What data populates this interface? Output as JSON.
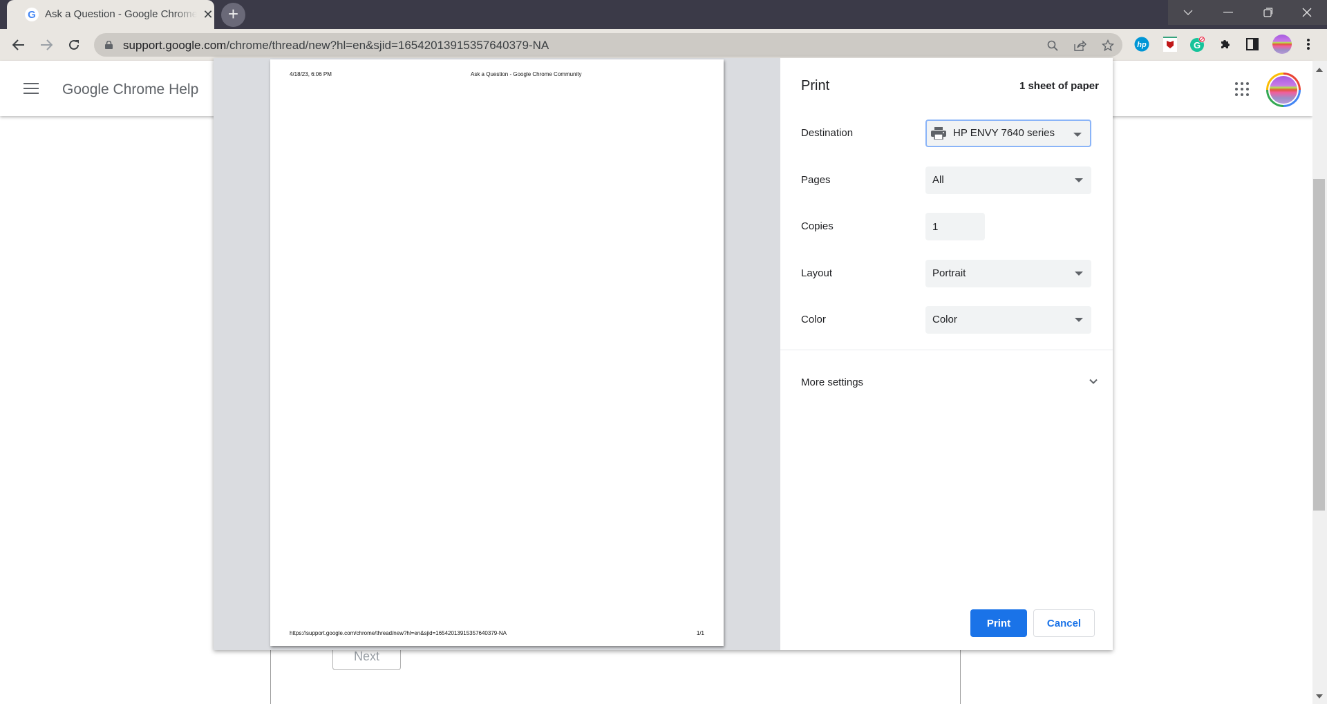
{
  "browser": {
    "tab": {
      "title": "Ask a Question - Google Chrome Community",
      "favicon": "G"
    },
    "new_tab_label": "+",
    "window_controls": {
      "tab_search": "chevron-down",
      "minimize": "minimize",
      "restore": "restore",
      "close": "close"
    },
    "url": {
      "host": "support.google.com",
      "path": "/chrome/thread/new?hl=en&sjid=16542013915357640379-NA"
    },
    "extensions": [
      "hp-smart",
      "mcafee",
      "grammarly",
      "extensions-puzzle",
      "side-panel"
    ]
  },
  "site": {
    "title": "Google Chrome Help",
    "next_button": "Next"
  },
  "print_preview": {
    "header_date": "4/18/23, 6:06 PM",
    "header_title": "Ask a Question - Google Chrome Community",
    "footer_url": "https://support.google.com/chrome/thread/new?hl=en&sjid=16542013915357640379-NA",
    "footer_page": "1/1"
  },
  "print_settings": {
    "heading": "Print",
    "sheet_count": "1 sheet of paper",
    "destination": {
      "label": "Destination",
      "value": "HP ENVY 7640 series"
    },
    "pages": {
      "label": "Pages",
      "value": "All"
    },
    "copies": {
      "label": "Copies",
      "value": "1"
    },
    "layout": {
      "label": "Layout",
      "value": "Portrait"
    },
    "color": {
      "label": "Color",
      "value": "Color"
    },
    "more_settings": "More settings",
    "print_button": "Print",
    "cancel_button": "Cancel",
    "accent_color": "#1a73e8"
  }
}
